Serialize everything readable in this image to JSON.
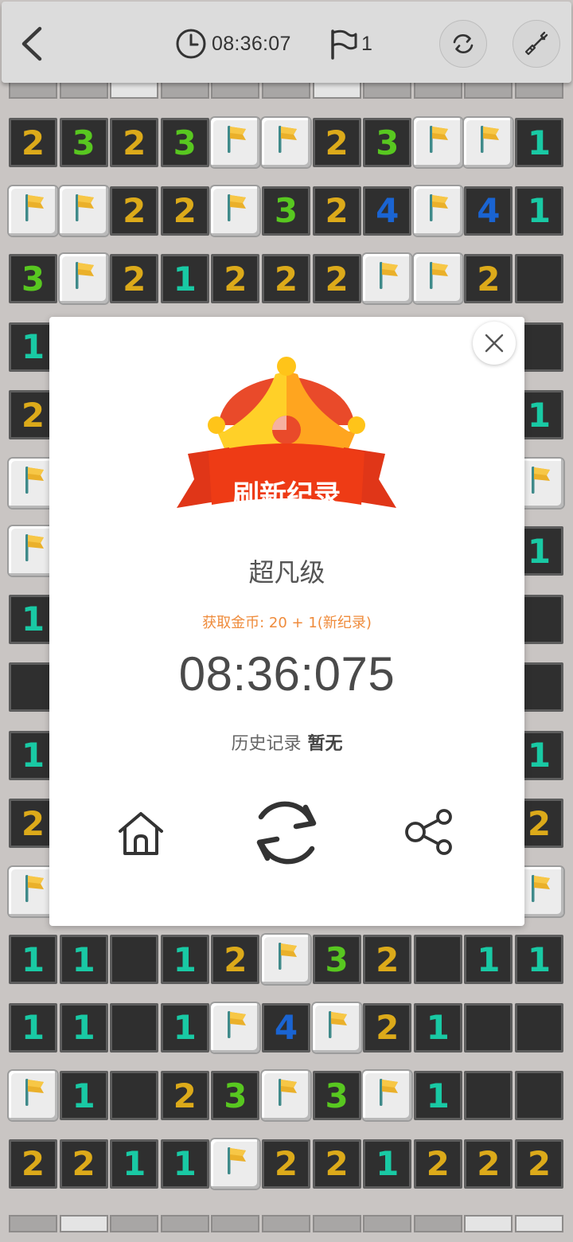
{
  "header": {
    "timer": "08:36:07",
    "flag_count": "1"
  },
  "board": {
    "rows": [
      [
        "2",
        "3",
        "2",
        "3",
        "F",
        "F",
        "2",
        "3",
        "F",
        "F",
        "1"
      ],
      [
        "F",
        "F",
        "2",
        "2",
        "F",
        "3",
        "2",
        "4",
        "F",
        "4",
        "1"
      ],
      [
        "3",
        "F",
        "2",
        "1",
        "2",
        "2",
        "2",
        "F",
        "F",
        "2",
        ""
      ],
      [
        "1",
        "",
        "",
        "",
        "",
        "",
        "",
        "",
        "",
        "",
        ""
      ],
      [
        "2",
        "",
        "",
        "",
        "",
        "",
        "",
        "",
        "",
        "",
        "1"
      ],
      [
        "F",
        "",
        "",
        "",
        "",
        "",
        "",
        "",
        "",
        "",
        "F"
      ],
      [
        "F",
        "",
        "",
        "",
        "",
        "",
        "",
        "",
        "",
        "",
        "1"
      ],
      [
        "1",
        "",
        "",
        "",
        "",
        "",
        "",
        "",
        "",
        "",
        ""
      ],
      [
        "",
        "",
        "",
        "",
        "",
        "",
        "",
        "",
        "",
        "",
        ""
      ],
      [
        "1",
        "",
        "",
        "",
        "",
        "",
        "",
        "",
        "",
        "",
        "1"
      ],
      [
        "2",
        "",
        "",
        "",
        "",
        "",
        "",
        "",
        "",
        "",
        "2"
      ],
      [
        "F",
        "",
        "",
        "",
        "",
        "",
        "",
        "",
        "",
        "",
        "F"
      ],
      [
        "1",
        "1",
        "",
        "1",
        "2",
        "F",
        "3",
        "2",
        "",
        "1",
        "1"
      ],
      [
        "1",
        "1",
        "",
        "1",
        "F",
        "4",
        "F",
        "2",
        "1",
        "",
        ""
      ],
      [
        "F",
        "1",
        "",
        "2",
        "3",
        "F",
        "3",
        "F",
        "1",
        "",
        ""
      ],
      [
        "2",
        "2",
        "1",
        "1",
        "F",
        "2",
        "2",
        "1",
        "2",
        "2",
        "2"
      ]
    ]
  },
  "dialog": {
    "ribbon_text": "刷新纪录",
    "level": "超凡级",
    "coins": "获取金币: 20 + 1(新纪录)",
    "time": "08:36:075",
    "history_label": "历史记录",
    "history_value": "暂无"
  },
  "colors": {
    "n1": "#19c9a4",
    "n2": "#dcaa1a",
    "n3": "#58c720",
    "n4": "#1a64d2",
    "coins_text": "#ef8b3b",
    "ribbon": "#e2441d"
  },
  "icons": {
    "back": "chevron-left-icon",
    "timer": "clock-icon",
    "flags": "flag-icon",
    "refresh": "refresh-icon",
    "shovel": "shovel-icon",
    "close": "close-icon",
    "home": "home-icon",
    "replay": "replay-icon",
    "share": "share-icon"
  }
}
